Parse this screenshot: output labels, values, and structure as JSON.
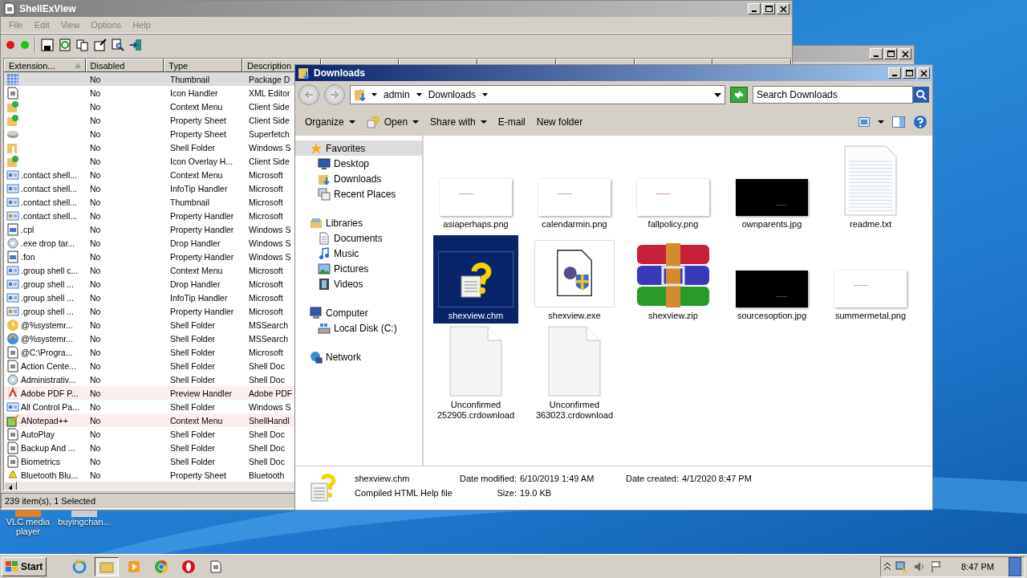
{
  "desktop": {
    "icons": [
      {
        "label": "VLC media player"
      },
      {
        "label": "buyingchan..."
      }
    ]
  },
  "shellexview": {
    "title": "ShellExView",
    "menu": [
      "File",
      "Edit",
      "View",
      "Options",
      "Help"
    ],
    "columns": [
      "Extension...",
      "Disabled",
      "Type",
      "Description"
    ],
    "rows": [
      {
        "disabled": "No",
        "type": "Thumbnail",
        "description": "Package D",
        "selected": true,
        "highlighted": false
      },
      {
        "disabled": "No",
        "type": "Icon Handler",
        "description": "XML Editor",
        "selected": false,
        "highlighted": false
      },
      {
        "disabled": "No",
        "type": "Context Menu",
        "description": "Client Side",
        "selected": false,
        "highlighted": false
      },
      {
        "disabled": "No",
        "type": "Property Sheet",
        "description": "Client Side",
        "selected": false,
        "highlighted": false
      },
      {
        "disabled": "No",
        "type": "Property Sheet",
        "description": "Superfetch",
        "selected": false,
        "highlighted": false
      },
      {
        "disabled": "No",
        "type": "Shell Folder",
        "description": "Windows S",
        "selected": false,
        "highlighted": false
      },
      {
        "disabled": "No",
        "type": "Icon Overlay H...",
        "description": "Client Side",
        "selected": false,
        "highlighted": false
      },
      {
        "extension": ".contact shell...",
        "disabled": "No",
        "type": "Context Menu",
        "description": "Microsoft",
        "selected": false,
        "highlighted": false
      },
      {
        "extension": ".contact shell...",
        "disabled": "No",
        "type": "InfoTip Handler",
        "description": "Microsoft",
        "selected": false,
        "highlighted": false
      },
      {
        "extension": ".contact shell...",
        "disabled": "No",
        "type": "Thumbnail",
        "description": "Microsoft",
        "selected": false,
        "highlighted": false
      },
      {
        "extension": ".contact shell...",
        "disabled": "No",
        "type": "Property Handler",
        "description": "Microsoft",
        "selected": false,
        "highlighted": false
      },
      {
        "extension": ".cpl",
        "disabled": "No",
        "type": "Property Handler",
        "description": "Windows S",
        "selected": false,
        "highlighted": false
      },
      {
        "extension": ".exe drop tar...",
        "disabled": "No",
        "type": "Drop Handler",
        "description": "Windows S",
        "selected": false,
        "highlighted": false
      },
      {
        "extension": ".fon",
        "disabled": "No",
        "type": "Property Handler",
        "description": "Windows S",
        "selected": false,
        "highlighted": false
      },
      {
        "extension": ".group shell c...",
        "disabled": "No",
        "type": "Context Menu",
        "description": "Microsoft",
        "selected": false,
        "highlighted": false
      },
      {
        "extension": ".group shell ...",
        "disabled": "No",
        "type": "Drop Handler",
        "description": "Microsoft",
        "selected": false,
        "highlighted": false
      },
      {
        "extension": ".group shell ...",
        "disabled": "No",
        "type": "InfoTip Handler",
        "description": "Microsoft",
        "selected": false,
        "highlighted": false
      },
      {
        "extension": ".group shell ...",
        "disabled": "No",
        "type": "Property Handler",
        "description": "Microsoft",
        "selected": false,
        "highlighted": false
      },
      {
        "extension": "@%systemr...",
        "disabled": "No",
        "type": "Shell Folder",
        "description": "MSSearch",
        "selected": false,
        "highlighted": false
      },
      {
        "extension": "@%systemr...",
        "disabled": "No",
        "type": "Shell Folder",
        "description": "MSSearch",
        "selected": false,
        "highlighted": false
      },
      {
        "extension": "@C:\\Progra...",
        "disabled": "No",
        "type": "Shell Folder",
        "description": "Microsoft",
        "selected": false,
        "highlighted": false
      },
      {
        "extension": "Action Cente...",
        "disabled": "No",
        "type": "Shell Folder",
        "description": "Shell Doc",
        "selected": false,
        "highlighted": false
      },
      {
        "extension": "Administrativ...",
        "disabled": "No",
        "type": "Shell Folder",
        "description": "Shell Doc",
        "selected": false,
        "highlighted": false
      },
      {
        "extension": "Adobe PDF P...",
        "disabled": "No",
        "type": "Preview Handler",
        "description": "Adobe PDF",
        "selected": false,
        "highlighted": true
      },
      {
        "extension": "All Control Pa...",
        "disabled": "No",
        "type": "Shell Folder",
        "description": "Windows S",
        "selected": false,
        "highlighted": false
      },
      {
        "extension": "ANotepad++",
        "disabled": "No",
        "type": "Context Menu",
        "description": "ShellHandl",
        "selected": false,
        "highlighted": true
      },
      {
        "extension": "AutoPlay",
        "disabled": "No",
        "type": "Shell Folder",
        "description": "Shell Doc",
        "selected": false,
        "highlighted": false
      },
      {
        "extension": "Backup And ...",
        "disabled": "No",
        "type": "Shell Folder",
        "description": "Shell Doc",
        "selected": false,
        "highlighted": false
      },
      {
        "extension": "Biometrics",
        "disabled": "No",
        "type": "Shell Folder",
        "description": "Shell Doc",
        "selected": false,
        "highlighted": false
      },
      {
        "extension": "Bluetooth Blu...",
        "disabled": "No",
        "type": "Property Sheet",
        "description": "Bluetooth",
        "selected": false,
        "highlighted": false
      }
    ],
    "status_bar": "239 item(s), 1 Selected"
  },
  "explorer": {
    "title": "Downloads",
    "breadcrumb": [
      "admin",
      "Downloads"
    ],
    "search": {
      "placeholder": "Search Downloads"
    },
    "commands": [
      {
        "label": "Organize",
        "dropdown": true
      },
      {
        "label": "Open",
        "dropdown": true
      },
      {
        "label": "Share with",
        "dropdown": true
      },
      {
        "label": "E-mail",
        "dropdown": false
      },
      {
        "label": "New folder",
        "dropdown": false
      }
    ],
    "nav": [
      {
        "label": "Favorites",
        "selected": true,
        "children": [
          {
            "label": "Desktop",
            "selected": false
          },
          {
            "label": "Downloads",
            "selected": false
          },
          {
            "label": "Recent Places",
            "selected": false
          }
        ]
      },
      {
        "label": "Libraries",
        "selected": false,
        "children": [
          {
            "label": "Documents",
            "selected": false
          },
          {
            "label": "Music",
            "selected": false
          },
          {
            "label": "Pictures",
            "selected": false
          },
          {
            "label": "Videos",
            "selected": false
          }
        ]
      },
      {
        "label": "Computer",
        "selected": false,
        "children": [
          {
            "label": "Local Disk (C:)",
            "selected": false
          }
        ]
      },
      {
        "label": "Network",
        "selected": false
      }
    ],
    "files": [
      {
        "name": "asiaperhaps.png",
        "kind": "light",
        "selected": false
      },
      {
        "name": "calendarmin.png",
        "kind": "light",
        "selected": false
      },
      {
        "name": "fallpolicy.png",
        "kind": "light",
        "selected": false
      },
      {
        "name": "ownparents.jpg",
        "kind": "dark",
        "selected": false
      },
      {
        "name": "readme.txt",
        "kind": "text",
        "selected": false
      },
      {
        "name": "shexview.chm",
        "kind": "help",
        "selected": true
      },
      {
        "name": "shexview.exe",
        "kind": "program",
        "selected": false
      },
      {
        "name": "shexview.zip",
        "kind": "archive",
        "selected": false
      },
      {
        "name": "sourcesoption.jpg",
        "kind": "dark",
        "selected": false
      },
      {
        "name": "summermetal.png",
        "kind": "light",
        "selected": false
      },
      {
        "name": "Unconfirmed 252905.crdownload",
        "kind": "blank",
        "selected": false
      },
      {
        "name": "Unconfirmed 363023.crdownload",
        "kind": "blank",
        "selected": false
      }
    ],
    "details": {
      "name": "shexview.chm",
      "type": "Compiled HTML Help file",
      "fields": [
        {
          "label": "Date modified:",
          "value": "6/10/2019 1:49 AM"
        },
        {
          "label": "Date created:",
          "value": "4/1/2020 8:47 PM"
        },
        {
          "label": "Size:",
          "value": "19.0 KB"
        }
      ]
    }
  },
  "taskbar": {
    "start": "Start",
    "clock": "8:47 PM"
  }
}
